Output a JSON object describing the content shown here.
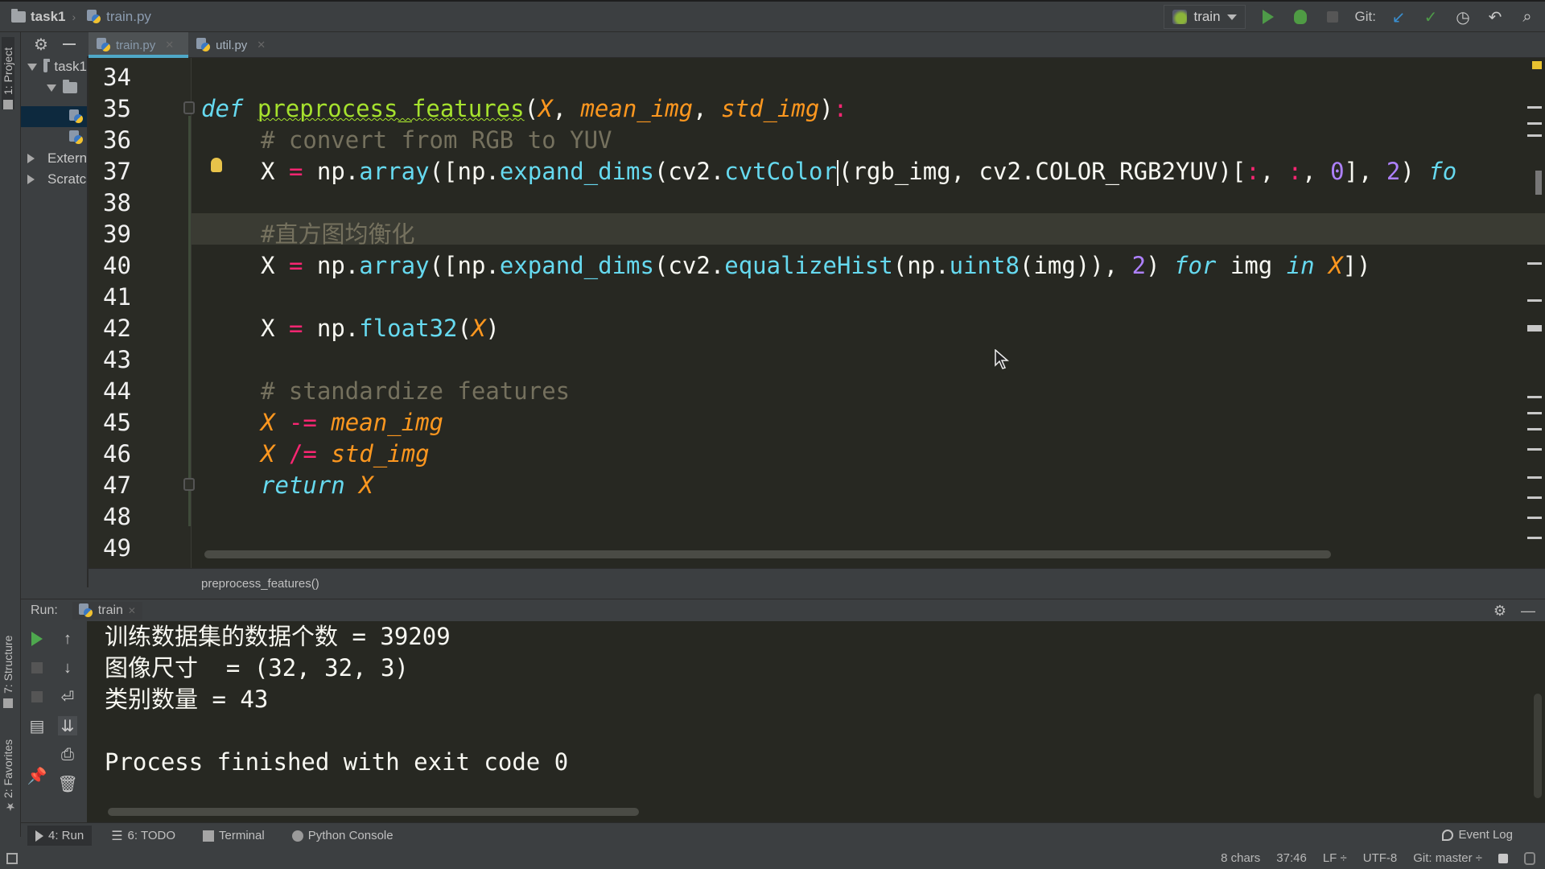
{
  "navbar": {
    "project": "task1",
    "file": "train.py"
  },
  "toolbar": {
    "run_config": "train",
    "git_label": "Git:",
    "icons": [
      "run-icon",
      "debug-icon",
      "stop-icon",
      "git-update-icon",
      "git-commit-icon",
      "history-icon",
      "revert-icon",
      "search-icon"
    ]
  },
  "left_stripe": {
    "project_tab": "1: Project",
    "structure_tab": "7: Structure",
    "favorites_tab": "2: Favorites"
  },
  "project_tree": {
    "root": "task1",
    "items": [
      {
        "label": "task1",
        "type": "folder",
        "expanded": true
      },
      {
        "label": "",
        "type": "folder",
        "expanded": true
      },
      {
        "label": "",
        "type": "python-file",
        "selected": true
      },
      {
        "label": "",
        "type": "python-file"
      },
      {
        "label": "External Libraries",
        "type": "libraries"
      },
      {
        "label": "Scratches and Consoles",
        "type": "scratches"
      }
    ]
  },
  "editor_tabs": [
    {
      "label": "train.py",
      "active": true
    },
    {
      "label": "util.py",
      "active": false
    }
  ],
  "editor": {
    "line_numbers": [
      "34",
      "35",
      "36",
      "37",
      "38",
      "39",
      "40",
      "41",
      "42",
      "43",
      "44",
      "45",
      "46",
      "47",
      "48",
      "49"
    ],
    "lines": {
      "l35": {
        "kw": "def",
        "fn": "preprocess_features",
        "p1": "X",
        "p2": "mean_img",
        "p3": "std_img"
      },
      "l36": "# convert from RGB to YUV",
      "l37": {
        "lhs": "X",
        "a": "np.",
        "b": "array",
        "c": "([np.",
        "d": "expand_dims",
        "e": "(cv2.",
        "f": "cvtColor",
        "g": "(rgb_img, cv2.COLOR_RGB2YUV)[",
        "h": ":",
        "i": ", ",
        "j": ":",
        "k": ", ",
        "l": "0",
        "m": "], ",
        "n": "2",
        "o": ") ",
        "p": "fo"
      },
      "l39": "#直方图均衡化",
      "l40": {
        "lhs": "X",
        "a": "np.",
        "b": "array",
        "c": "([np.",
        "d": "expand_dims",
        "e": "(cv2.",
        "f": "equalizeHist",
        "g": "(np.",
        "h": "uint8",
        "i": "(img)), ",
        "j": "2",
        "k": ") ",
        "l": "for",
        "m": " img ",
        "n": "in",
        "o": " ",
        "p": "X",
        "q": "])"
      },
      "l42": {
        "lhs": "X",
        "a": "np.",
        "b": "float32",
        "c": "(",
        "d": "X",
        "e": ")"
      },
      "l44": "# standardize features",
      "l45": {
        "a": "X",
        "op": "-=",
        "b": "mean_img"
      },
      "l46": {
        "a": "X",
        "op": "/=",
        "b": "std_img"
      },
      "l47": {
        "kw": "return",
        "v": "X"
      }
    }
  },
  "breadcrumb": "preprocess_features()",
  "run_panel": {
    "label": "Run:",
    "tab": "train",
    "output": [
      "训练数据集的数据个数 = 39209",
      "图像尺寸  = (32, 32, 3)",
      "类别数量 = 43",
      "",
      "Process finished with exit code 0"
    ]
  },
  "tool_windows": [
    {
      "label": "4: Run",
      "active": true
    },
    {
      "label": "6: TODO",
      "active": false
    },
    {
      "label": "Terminal",
      "active": false
    },
    {
      "label": "Python Console",
      "active": false
    }
  ],
  "event_log": "Event Log",
  "status_bar": {
    "selection": "8 chars",
    "position": "37:46",
    "line_sep": "LF ÷",
    "encoding": "UTF-8",
    "vcs": "Git: master ÷"
  }
}
